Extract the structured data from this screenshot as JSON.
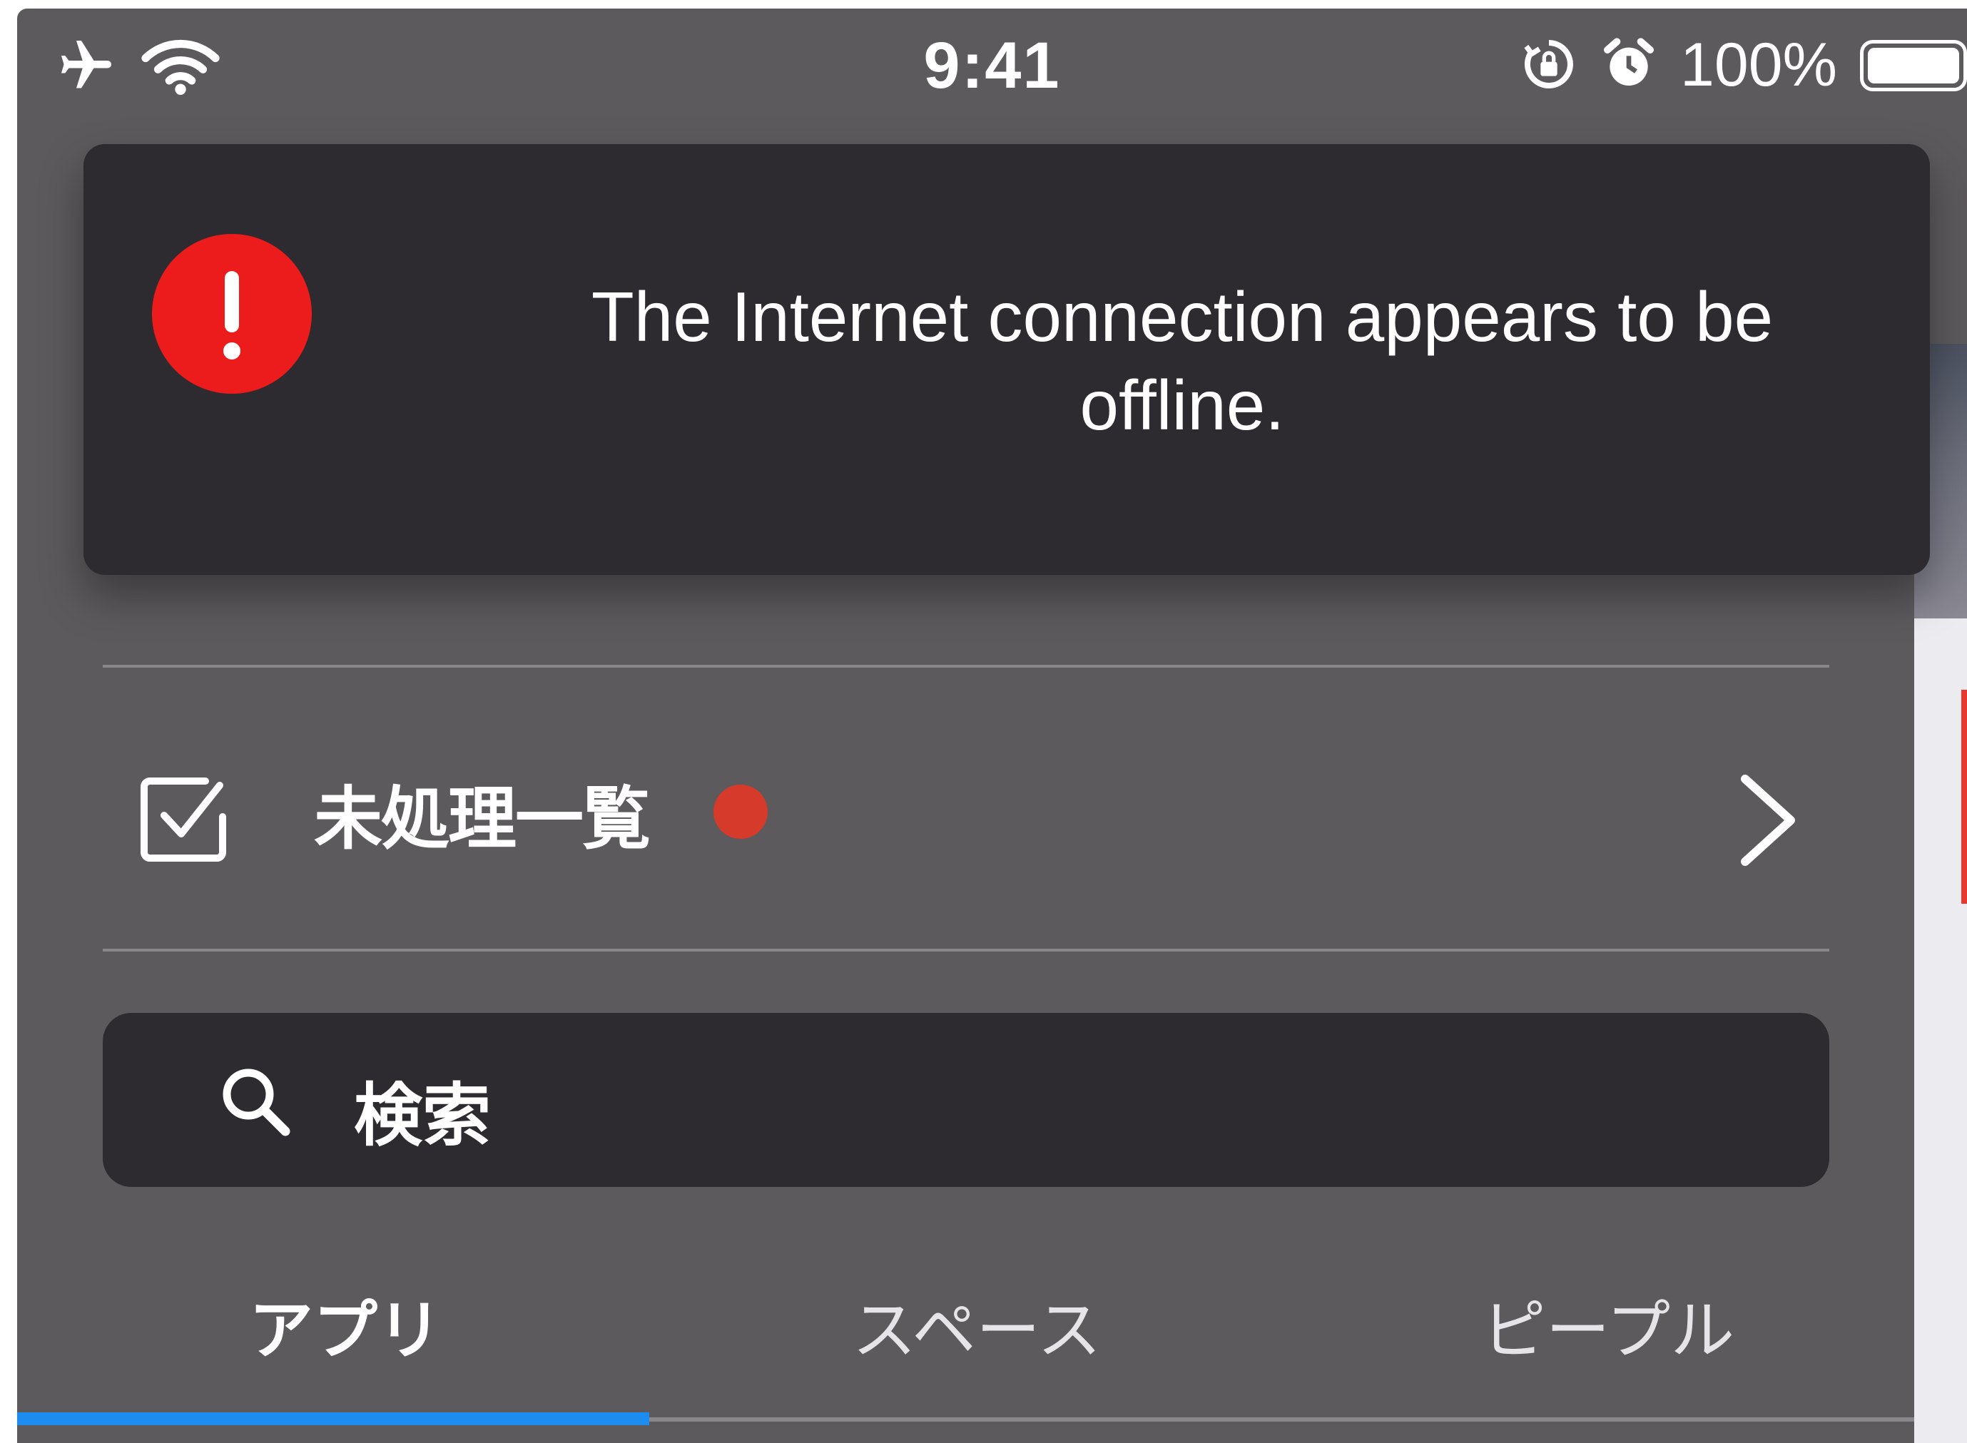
{
  "status_bar": {
    "time": "9:41",
    "battery_percent": "100%",
    "battery_level": 1.0,
    "left_icons": [
      "airplane-icon",
      "wifi-icon"
    ],
    "right_icons": [
      "orientation-lock-icon",
      "alarm-icon",
      "battery-icon"
    ]
  },
  "toast": {
    "icon": "exclamation-icon",
    "message": "The Internet connection appears to be offline.",
    "icon_color": "#ec1c1c"
  },
  "pending": {
    "label": "未処理一覧",
    "has_badge": true,
    "badge_color": "#d63a2a",
    "icon": "checkbox-icon",
    "chevron": "chevron-right-icon"
  },
  "search": {
    "placeholder": "検索",
    "icon": "search-icon"
  },
  "tabs": [
    {
      "label": "アプリ",
      "active": true
    },
    {
      "label": "スペース",
      "active": false
    },
    {
      "label": "ピープル",
      "active": false
    }
  ],
  "colors": {
    "background": "#5d5a5e",
    "panel": "#2d2b2f",
    "accent": "#1c8cf0"
  }
}
